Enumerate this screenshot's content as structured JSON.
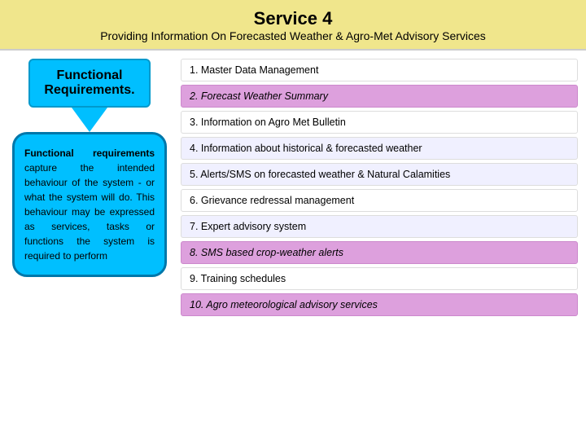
{
  "header": {
    "title": "Service 4",
    "subtitle": "Providing Information On Forecasted Weather & Agro-Met Advisory Services"
  },
  "left": {
    "func_req_label": "Functional Requirements.",
    "func_desc": {
      "bold_part": "Functional   requirements",
      "rest": " capture   the   intended behaviour  of  the  system  -  or what  the  system  will  do.  This behaviour  may  be  expressed as  services,  tasks  or  functions the  system  is  required  to perform"
    }
  },
  "requirements": [
    {
      "text": "1. Master Data Management",
      "style": "white"
    },
    {
      "text": "2. Forecast Weather Summary",
      "style": "highlight"
    },
    {
      "text": "3. Information on Agro Met Bulletin",
      "style": "white"
    },
    {
      "text": "4. Information about historical & forecasted weather",
      "style": "plain"
    },
    {
      "text": "5. Alerts/SMS on forecasted weather & Natural Calamities",
      "style": "plain"
    },
    {
      "text": "6. Grievance redressal management",
      "style": "white"
    },
    {
      "text": "7. Expert advisory system",
      "style": "plain"
    },
    {
      "text": "8. SMS based crop-weather alerts",
      "style": "highlight"
    },
    {
      "text": "9. Training schedules",
      "style": "white"
    },
    {
      "text": "10. Agro meteorological advisory services",
      "style": "highlight"
    }
  ]
}
